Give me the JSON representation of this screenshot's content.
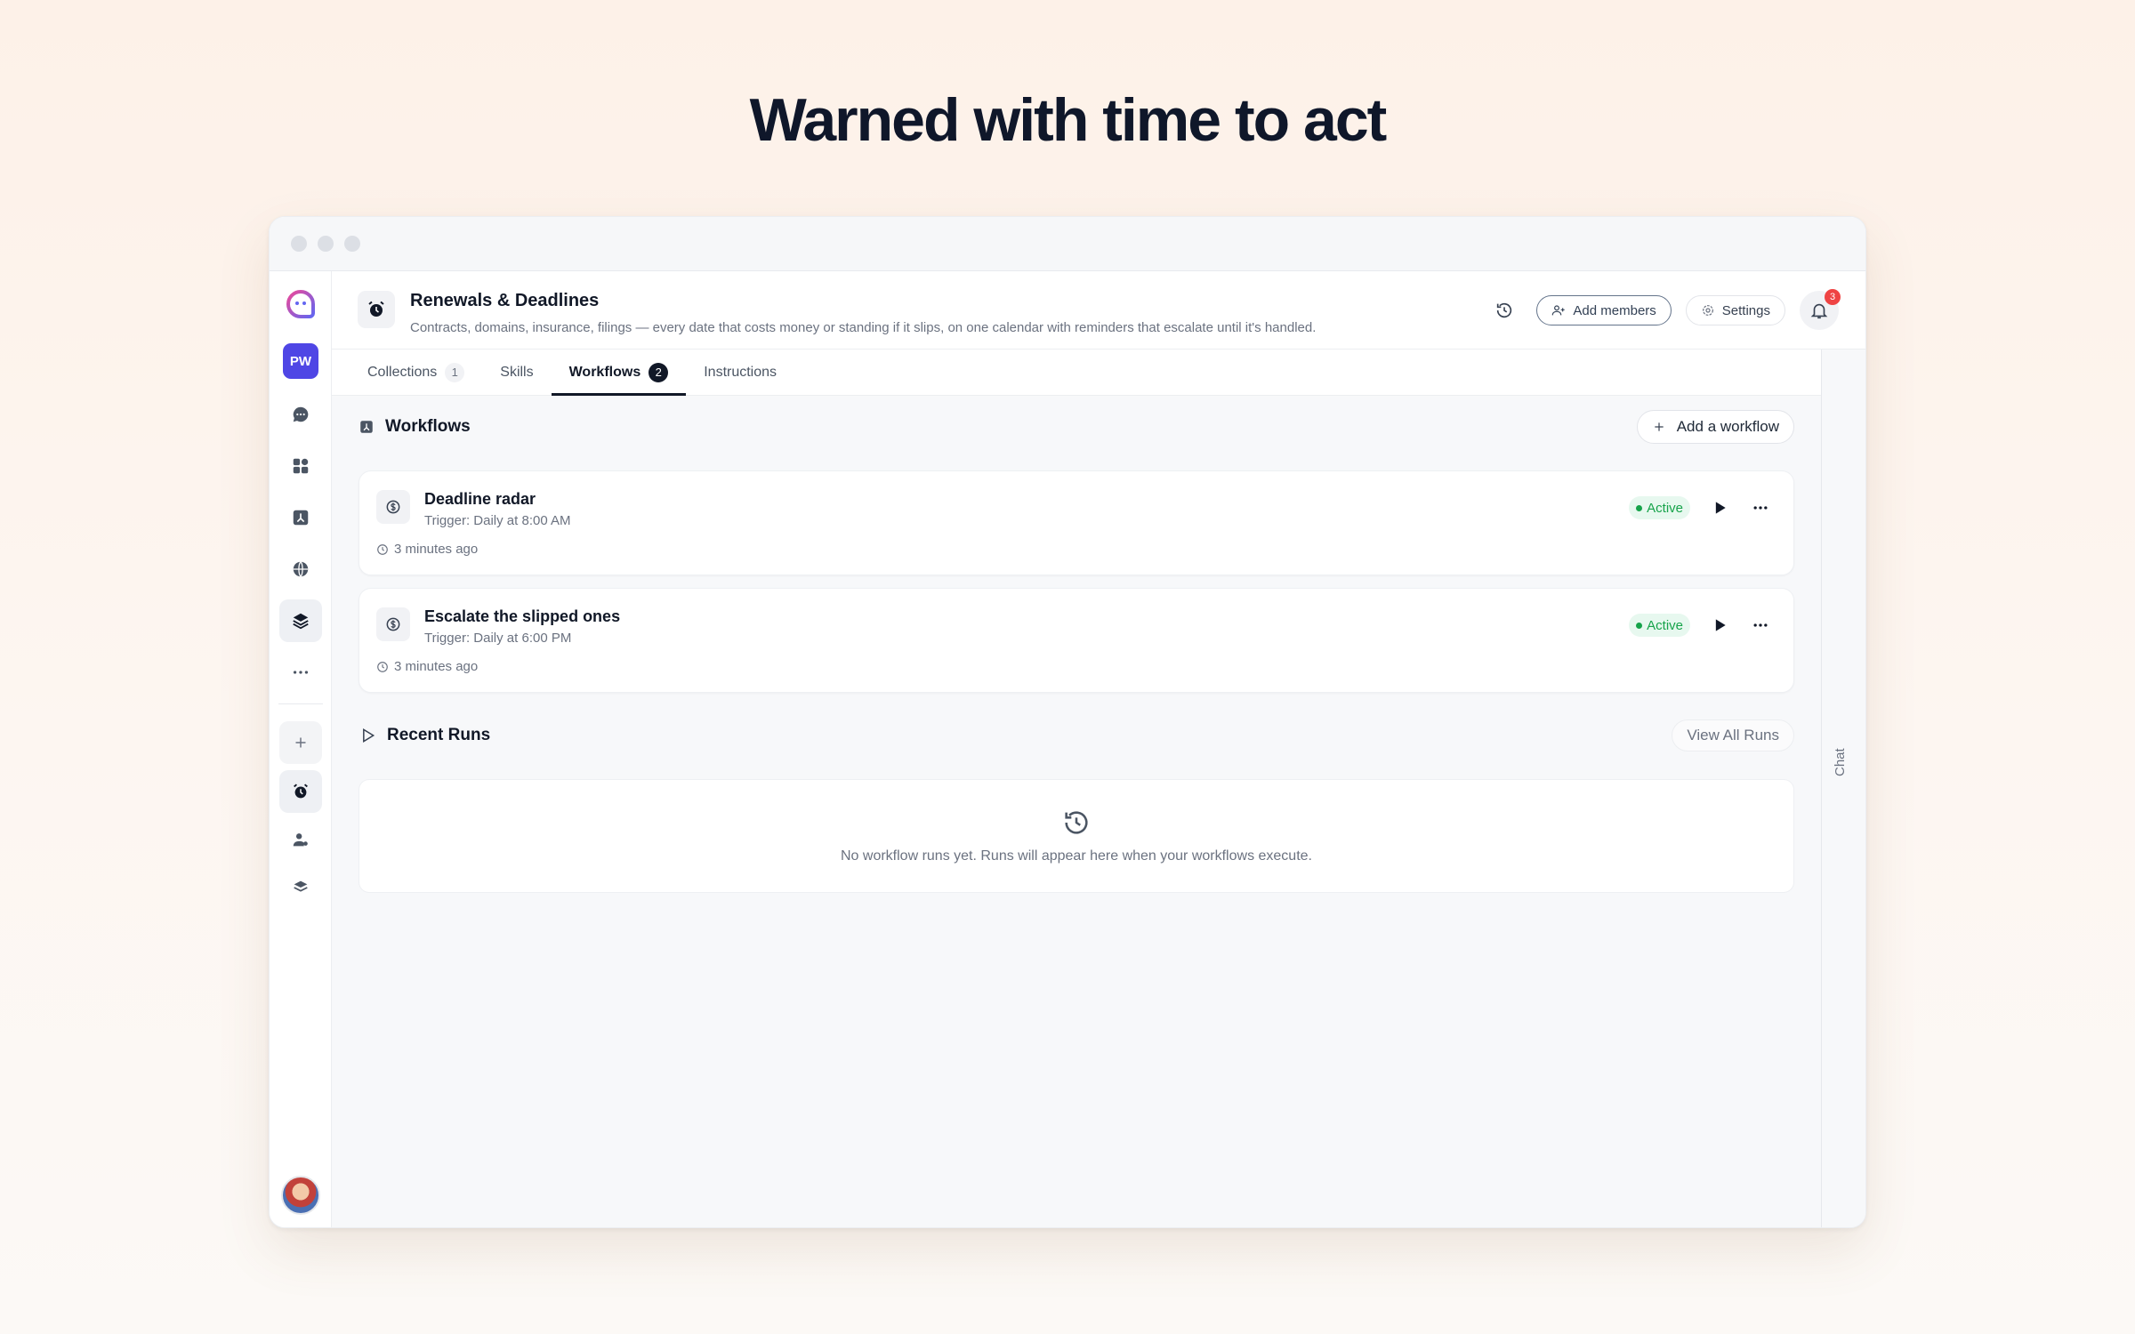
{
  "headline": "Warned with time to act",
  "workspace": {
    "title": "Renewals & Deadlines",
    "description": "Contracts, domains, insurance, filings — every date that costs money or standing if it slips, on one calendar with reminders that escalate until it's handled."
  },
  "header_actions": {
    "add_members": "Add members",
    "settings": "Settings",
    "notification_count": "3"
  },
  "sidebar": {
    "badge": "PW",
    "items": [
      "chat-icon",
      "apps-icon",
      "workflow-icon",
      "globe-icon",
      "layers-icon",
      "more-icon"
    ],
    "secondary": [
      "plus-icon",
      "alarm-icon",
      "user-gear-icon",
      "stack-icon"
    ]
  },
  "tabs": [
    {
      "label": "Collections",
      "count": "1"
    },
    {
      "label": "Skills",
      "count": ""
    },
    {
      "label": "Workflows",
      "count": "2"
    },
    {
      "label": "Instructions",
      "count": ""
    }
  ],
  "workflows_section": {
    "title": "Workflows",
    "add_button": "Add a workflow"
  },
  "workflows": [
    {
      "name": "Deadline radar",
      "trigger": "Trigger: Daily at 8:00 AM",
      "updated": "3 minutes ago",
      "status": "Active"
    },
    {
      "name": "Escalate the slipped ones",
      "trigger": "Trigger: Daily at 6:00 PM",
      "updated": "3 minutes ago",
      "status": "Active"
    }
  ],
  "recent_runs": {
    "title": "Recent Runs",
    "view_all": "View All Runs",
    "empty_message": "No workflow runs yet. Runs will appear here when your workflows execute."
  },
  "chat_label": "Chat",
  "colors": {
    "accent": "#4f46e5",
    "status_active": "#16a34a",
    "badge": "#ef4444"
  }
}
